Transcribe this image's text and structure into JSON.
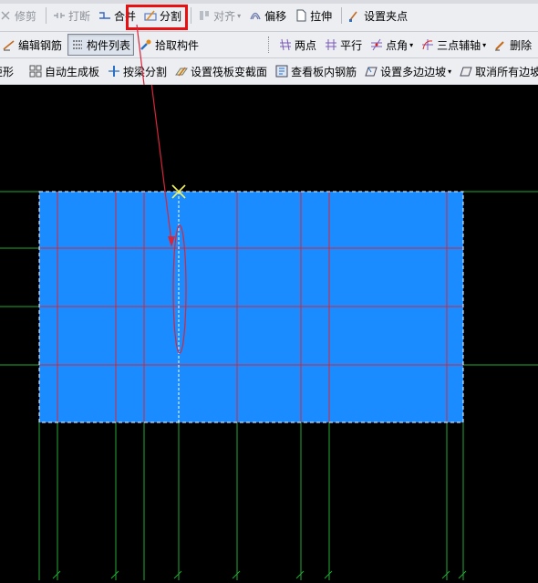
{
  "toolbar1": {
    "trim_label": "修剪",
    "break_label": "打断",
    "merge_label": "合并",
    "split_label": "分割",
    "align_label": "对齐",
    "offset_label": "偏移",
    "stretch_label": "拉伸",
    "set_grip_label": "设置夹点"
  },
  "toolbar2": {
    "edit_rebar_label": "编辑钢筋",
    "component_list_label": "构件列表",
    "pick_component_label": "拾取构件",
    "two_points_label": "两点",
    "parallel_label": "平行",
    "point_angle_label": "点角",
    "three_point_axis_label": "三点辅轴",
    "delete_label": "删除"
  },
  "toolbar3": {
    "rect_label": "矩形",
    "auto_generate_slab_label": "自动生成板",
    "split_by_beam_label": "按梁分割",
    "set_raft_section_label": "设置筏板变截面",
    "view_slab_rebar_label": "查看板内钢筋",
    "set_polygon_slope_label": "设置多边边坡",
    "cancel_all_slopes_label": "取消所有边坡"
  },
  "colors": {
    "slab_fill": "#1a8cff",
    "grid_line": "#d8253a",
    "axis_line": "#22aa33",
    "annotation": "#e81010",
    "cursor": "#f2f25a",
    "background": "#000000"
  },
  "icons": [
    "scissors-icon",
    "break-icon",
    "merge-icon",
    "split-icon",
    "align-icon",
    "offset-icon",
    "stretch-icon",
    "grip-icon",
    "edit-rebar-icon",
    "list-icon",
    "pick-icon",
    "two-points-icon",
    "parallel-icon",
    "point-angle-icon",
    "three-point-axis-icon",
    "delete-icon",
    "grid-icon",
    "auto-slab-icon",
    "split-beam-icon",
    "raft-section-icon",
    "view-rebar-icon",
    "polygon-slope-icon",
    "cancel-slope-icon"
  ]
}
